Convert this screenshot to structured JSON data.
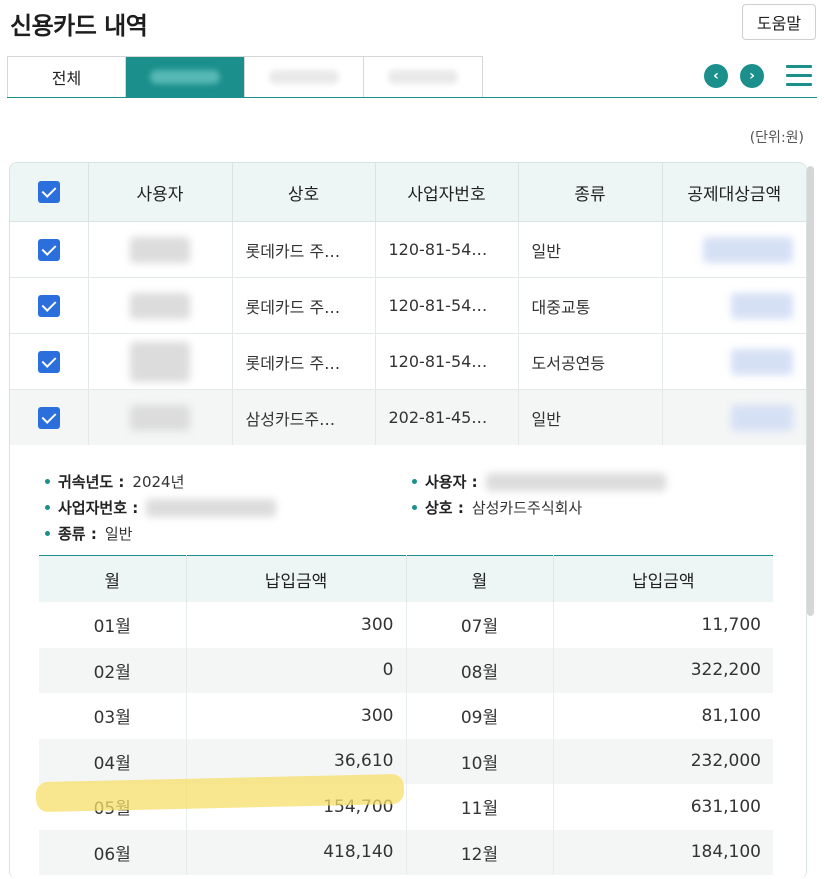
{
  "header": {
    "title": "신용카드 내역",
    "help_label": "도움말"
  },
  "tabs": [
    {
      "label": "전체",
      "state": "normal"
    },
    {
      "label": "",
      "state": "active"
    },
    {
      "label": "",
      "state": "normal"
    },
    {
      "label": "",
      "state": "normal"
    }
  ],
  "nav": {
    "prev_glyph": "‹",
    "next_glyph": "›"
  },
  "unit_label": "(단위:원)",
  "table": {
    "headers": [
      "사용자",
      "상호",
      "사업자번호",
      "종류",
      "공제대상금액"
    ],
    "rows": [
      {
        "company": "롯데카드 주…",
        "biz_no": "120-81-54…",
        "type": "일반"
      },
      {
        "company": "롯데카드 주…",
        "biz_no": "120-81-54…",
        "type": "대중교통"
      },
      {
        "company": "롯데카드 주…",
        "biz_no": "120-81-54…",
        "type": "도서공연등"
      },
      {
        "company": "삼성카드주…",
        "biz_no": "202-81-45…",
        "type": "일반"
      }
    ]
  },
  "detail": {
    "year_label": "귀속년도 :",
    "year_value": "2024년",
    "user_label": "사용자 :",
    "biz_label": "사업자번호 :",
    "company_label": "상호 :",
    "company_value": "삼성카드주식회사",
    "type_label": "종류 :",
    "type_value": "일반"
  },
  "monthly": {
    "headers": [
      "월",
      "납입금액",
      "월",
      "납입금액"
    ],
    "rows": [
      {
        "m1": "01월",
        "a1": "300",
        "m2": "07월",
        "a2": "11,700"
      },
      {
        "m1": "02월",
        "a1": "0",
        "m2": "08월",
        "a2": "322,200"
      },
      {
        "m1": "03월",
        "a1": "300",
        "m2": "09월",
        "a2": "81,100"
      },
      {
        "m1": "04월",
        "a1": "36,610",
        "m2": "10월",
        "a2": "232,000"
      },
      {
        "m1": "05월",
        "a1": "154,700",
        "m2": "11월",
        "a2": "631,100"
      },
      {
        "m1": "06월",
        "a1": "418,140",
        "m2": "12월",
        "a2": "184,100"
      }
    ]
  },
  "colors": {
    "accent": "#1b8f8c",
    "checkbox": "#2a6fdb",
    "highlight": "#f7df6a"
  }
}
